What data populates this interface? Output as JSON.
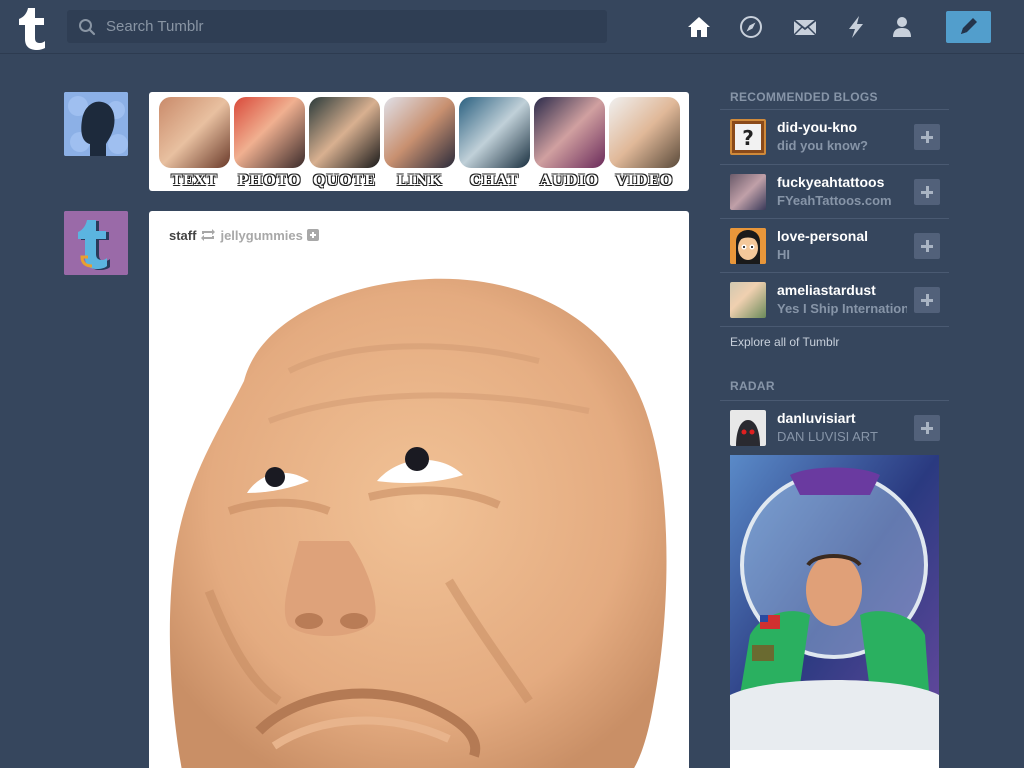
{
  "header": {
    "search_placeholder": "Search Tumblr",
    "nav_icons": [
      "home-icon",
      "compass-icon",
      "mail-icon",
      "lightning-icon",
      "person-icon"
    ],
    "compose_icon": "pencil-icon",
    "accent_color": "#529ecc"
  },
  "type_bar": {
    "items": [
      {
        "label": "TEXT"
      },
      {
        "label": "PHOTO"
      },
      {
        "label": "QUOTE"
      },
      {
        "label": "LINK"
      },
      {
        "label": "CHAT"
      },
      {
        "label": "AUDIO"
      },
      {
        "label": "VIDEO"
      }
    ]
  },
  "post": {
    "author": "staff",
    "reblogged_from": "jellygummies"
  },
  "sidebar": {
    "recommended_title": "RECOMMENDED BLOGS",
    "blogs": [
      {
        "name": "did-you-kno",
        "subtitle": "did you know?"
      },
      {
        "name": "fuckyeahtattoos",
        "subtitle": "FYeahTattoos.com"
      },
      {
        "name": "love-personal",
        "subtitle": "HI"
      },
      {
        "name": "ameliastardust",
        "subtitle": "Yes I Ship International"
      }
    ],
    "explore_link": "Explore all of Tumblr",
    "radar_title": "RADAR",
    "radar": {
      "name": "danluvisiart",
      "subtitle": "DAN LUVISI ART"
    }
  },
  "colors": {
    "background": "#36465d",
    "muted_text": "#8795a8"
  }
}
